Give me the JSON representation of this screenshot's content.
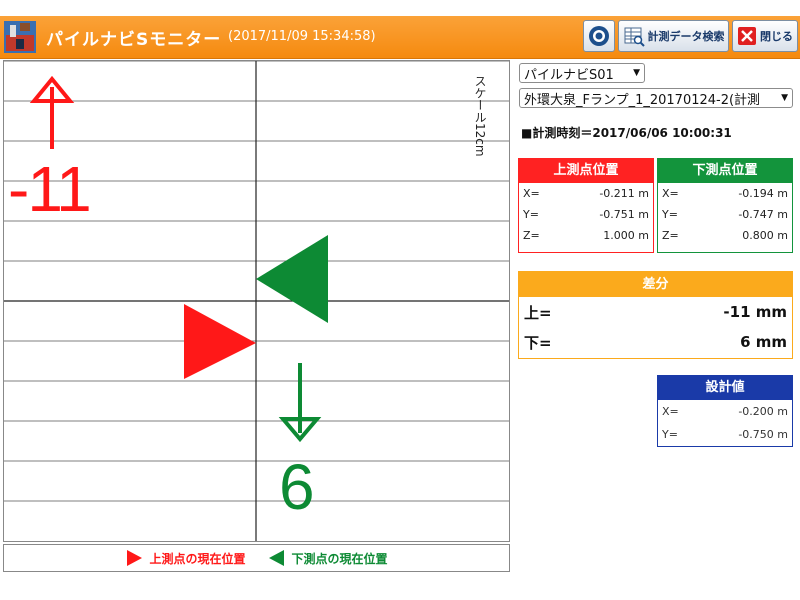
{
  "header": {
    "title": "パイルナビSモニター",
    "timestamp": "(2017/11/09 15:34:58)",
    "search_label": "計測データ検索",
    "close_label": "閉じる"
  },
  "monitor": {
    "scale_label": "スケール12cm",
    "upper_value": "-11",
    "lower_value": "6",
    "upper_color": "#ff1818",
    "lower_color": "#0d8a34",
    "legend": {
      "upper": "上測点の現在位置",
      "lower": "下測点の現在位置"
    }
  },
  "controls": {
    "pile_select": "パイルナビS01",
    "job_select": "外環大泉_Fランプ_1_20170124-2(計測"
  },
  "measure_time": "■計測時刻＝2017/06/06 10:00:31",
  "upper_point": {
    "title": "上測点位置",
    "rows": [
      {
        "label": "X=",
        "value": "-0.211 m"
      },
      {
        "label": "Y=",
        "value": "-0.751 m"
      },
      {
        "label": "Z=",
        "value": "1.000 m"
      }
    ]
  },
  "lower_point": {
    "title": "下測点位置",
    "rows": [
      {
        "label": "X=",
        "value": "-0.194 m"
      },
      {
        "label": "Y=",
        "value": "-0.747 m"
      },
      {
        "label": "Z=",
        "value": "0.800 m"
      }
    ]
  },
  "difference": {
    "title": "差分",
    "rows": [
      {
        "label": "上=",
        "value": "-11 mm"
      },
      {
        "label": "下=",
        "value": "6 mm"
      }
    ]
  },
  "design": {
    "title": "設計値",
    "rows": [
      {
        "label": "X=",
        "value": "-0.200 m"
      },
      {
        "label": "Y=",
        "value": "-0.750 m"
      }
    ]
  },
  "icons": [
    "app-logo-icon",
    "camera-icon",
    "search-data-icon",
    "close-x-icon",
    "dropdown-arrow-icon",
    "up-arrow-icon",
    "down-arrow-icon"
  ]
}
